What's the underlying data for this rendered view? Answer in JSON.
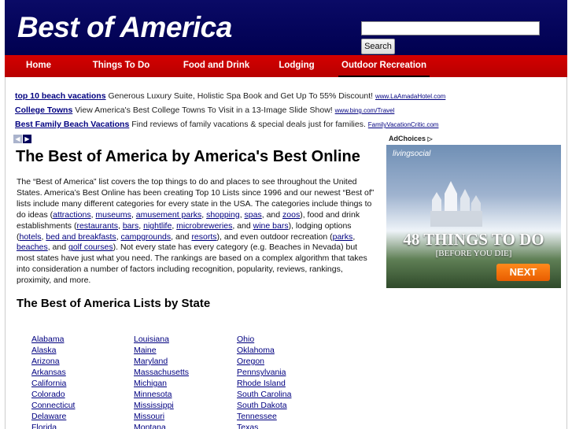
{
  "site": {
    "title": "Best of America"
  },
  "search": {
    "placeholder": "",
    "button_label": "Search"
  },
  "nav": [
    {
      "label": "Home"
    },
    {
      "label": "Things To Do"
    },
    {
      "label": "Food and Drink"
    },
    {
      "label": "Lodging"
    },
    {
      "label": "Outdoor Recreation"
    }
  ],
  "ads": [
    {
      "title": "top 10 beach vacations",
      "text": "Generous Luxury Suite, Holistic Spa Book and Get Up To 55% Discount!",
      "url": "www.LaAmadaHotel.com"
    },
    {
      "title": "College Towns",
      "text": "View America's Best College Towns To Visit in a 13-Image Slide Show!",
      "url": "www.bing.com/Travel"
    },
    {
      "title": "Best Family Beach Vacations",
      "text": "Find reviews of family vacations & special deals just for families.",
      "url": "FamilyVacationCritic.com"
    }
  ],
  "main": {
    "title": "The Best of America by America's Best Online",
    "intro_before": "The “Best of America” list covers the top things to do and places to see throughout the United States. America’s Best Online has been creating Top 10 Lists since 1996 and our newest “Best of” lists include many different categories for every state in the USA. The categories include things to do ideas (",
    "links": {
      "attractions": "attractions",
      "museums": "museums",
      "amusement_parks": "amusement parks",
      "shopping": "shopping",
      "spas": "spas",
      "zoos": "zoos",
      "restaurants": "restaurants",
      "bars": "bars",
      "nightlife": "nightlife",
      "microbreweries": "microbreweries",
      "wine_bars": "wine bars",
      "hotels": "hotels",
      "bed_and_breakfasts": "bed and breakfasts",
      "campgrounds": "campgrounds",
      "resorts": "resorts",
      "parks": "parks",
      "beaches": "beaches",
      "golf_courses": "golf courses"
    },
    "intro_after": "). Not every state has every category (e.g. Beaches in Nevada) but most states have just what you need. The rankings are based on a complex algorithm that takes into consideration a number of factors including recognition, popularity, reviews, rankings, proximity, and more.",
    "states_title": "The Best of America Lists by State"
  },
  "sidebar_ad": {
    "adchoices": "AdChoices",
    "brand": "livingsocial",
    "headline": "48 THINGS TO DO",
    "subline": "[BEFORE YOU DIE]",
    "next": "NEXT"
  },
  "states": [
    [
      "Alabama",
      "Alaska",
      "Arizona",
      "Arkansas",
      "California",
      "Colorado",
      "Connecticut",
      "Delaware",
      "Florida"
    ],
    [
      "Louisiana",
      "Maine",
      "Maryland",
      "Massachusetts",
      "Michigan",
      "Minnesota",
      "Mississippi",
      "Missouri",
      "Montana"
    ],
    [
      "Ohio",
      "Oklahoma",
      "Oregon",
      "Pennsylvania",
      "Rhode Island",
      "South Carolina",
      "South Dakota",
      "Tennessee",
      "Texas"
    ]
  ]
}
